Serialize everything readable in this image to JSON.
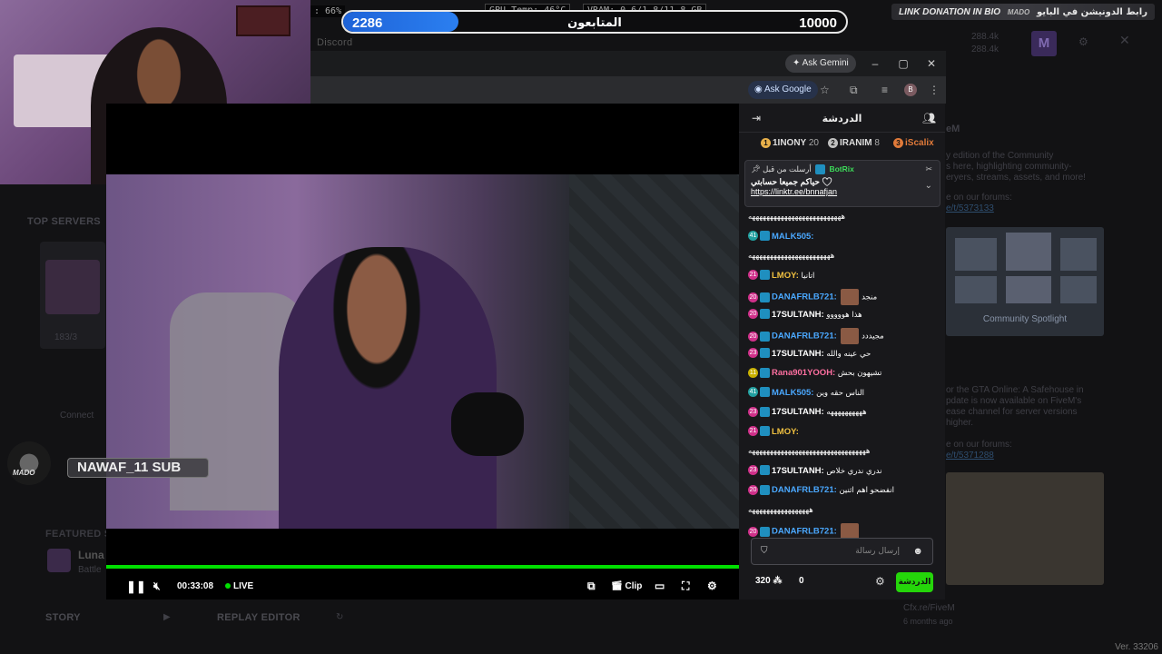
{
  "hud": {
    "fps_partial": ": 66%",
    "gpu_temp": "GPU Temp: 46°C",
    "vram": "VRAM: 0.6/1.8/11.8 GB",
    "goal_current": "2286",
    "goal_target": "10000",
    "goal_fraction": 0.2286,
    "goal_label": "المتابعون"
  },
  "banner": {
    "left_text": "LINK DONATION IN BIO",
    "right_text": "رابط الدونيشن في البايو",
    "logo_text": "MADO"
  },
  "background": {
    "discord_link": "Discord",
    "top_servers": "TOP SERVERS",
    "featured": "FEATURED SE",
    "server_name": "Luna",
    "server_sub": "Battle",
    "players_count": "183/3",
    "connect": "Connect",
    "story": "STORY",
    "replay_editor": "REPLAY EDITOR",
    "stat1": "288.4k",
    "stat2": "288.4k",
    "m_avatar": "M",
    "news_title": "eM",
    "news_text1": "y edition of the Community",
    "news_text2": "s here, highlighting community-",
    "news_text3": "eryers, streams, assets, and more!",
    "news_forum1": "e on our forums:",
    "news_link1": "e/t/5373133",
    "news_text4": "or the GTA Online: A Safehouse in",
    "news_text5": "pdate is now available on FiveM's",
    "news_text6": "ease channel for server versions",
    "news_text7": "higher.",
    "news_forum2": "e on our forums:",
    "news_link2": "e/t/5371288",
    "cfx": "Cfx.re/FiveM",
    "ago": "6 months ago",
    "version": "Ver. 33206",
    "spotlight": "Community Spotlight"
  },
  "browser": {
    "ask_gemini": "Ask Gemini",
    "ask_google": "Ask Google",
    "avatar_letter": "B"
  },
  "player": {
    "time": "00:33:08",
    "live": "LIVE",
    "clip": "Clip",
    "progress": 1.0
  },
  "sub": {
    "name": "NAWAF_11 SUB",
    "logo": "MADO"
  },
  "chat": {
    "title": "الدردشة",
    "leaderboard": [
      {
        "rank": "1",
        "name": "1INONY",
        "count": "20",
        "color": "#e8b04a"
      },
      {
        "rank": "2",
        "name": "IRANIM",
        "count": "8",
        "color": "#c0c0c0"
      },
      {
        "rank": "3",
        "name": "iScalix",
        "count": "",
        "color": "#e07a3a"
      }
    ],
    "pinned": {
      "sent_by": "أرسلت من قبل",
      "bot": "BotRix",
      "text": "حياكم جميعا حسابتي",
      "link": "https://linktr.ee/bnnafjan"
    },
    "messages": [
      {
        "badge": "",
        "badge_color": "",
        "user": "",
        "user_color": "#fff",
        "text": "ههههههههههههههههههههههههههه",
        "emote": false
      },
      {
        "badge": "41",
        "badge_color": "#22a0a0",
        "user": "MALK505:",
        "user_color": "#4aa8ff",
        "text": "",
        "emote": false
      },
      {
        "badge": "",
        "badge_color": "",
        "user": "",
        "user_color": "#fff",
        "text": "هههههههههههههههههههههههه",
        "emote": false
      },
      {
        "badge": "21",
        "badge_color": "#d0308a",
        "user": "LMOY:",
        "user_color": "#f0c040",
        "text": "اتانيا",
        "emote": false
      },
      {
        "badge": "20",
        "badge_color": "#d0308a",
        "user": "DANAFRLB721:",
        "user_color": "#4aa8ff",
        "text": "منجد",
        "emote": true
      },
      {
        "badge": "20",
        "badge_color": "#d0308a",
        "user": "17SULTANH:",
        "user_color": "#ffffff",
        "text": "هذا هووووو",
        "emote": false
      },
      {
        "badge": "20",
        "badge_color": "#d0308a",
        "user": "DANAFRLB721:",
        "user_color": "#4aa8ff",
        "text": "مجيددد",
        "emote": true
      },
      {
        "badge": "23",
        "badge_color": "#d0308a",
        "user": "17SULTANH:",
        "user_color": "#ffffff",
        "text": "حي عينه والله",
        "emote": false
      },
      {
        "badge": "11",
        "badge_color": "#c8b000",
        "user": "Rana901YOOH:",
        "user_color": "#ff6fa0",
        "text": "تشيهون بحش",
        "emote": false
      },
      {
        "badge": "41",
        "badge_color": "#22a0a0",
        "user": "MALK505:",
        "user_color": "#4aa8ff",
        "text": "الناس حقه وين",
        "emote": false
      },
      {
        "badge": "23",
        "badge_color": "#d0308a",
        "user": "17SULTANH:",
        "user_color": "#ffffff",
        "text": "ههههههههههه",
        "emote": false
      },
      {
        "badge": "21",
        "badge_color": "#d0308a",
        "user": "LMOY:",
        "user_color": "#f0c040",
        "text": "",
        "emote": false
      },
      {
        "badge": "",
        "badge_color": "",
        "user": "",
        "user_color": "#fff",
        "text": "هههههههههههههههههههههههههههههههههه",
        "emote": false
      },
      {
        "badge": "23",
        "badge_color": "#d0308a",
        "user": "17SULTANH:",
        "user_color": "#ffffff",
        "text": "ندري ندري خلاص",
        "emote": false
      },
      {
        "badge": "20",
        "badge_color": "#d0308a",
        "user": "DANAFRLB721:",
        "user_color": "#4aa8ff",
        "text": "انفضحو اهم اثنين",
        "emote": false
      },
      {
        "badge": "",
        "badge_color": "",
        "user": "",
        "user_color": "#fff",
        "text": "هههههههههههههههههه",
        "emote": false
      },
      {
        "badge": "20",
        "badge_color": "#d0308a",
        "user": "DANAFRLB721:",
        "user_color": "#4aa8ff",
        "text": "",
        "emote": true
      }
    ],
    "input_placeholder": "إرسال رسالة",
    "points": "320",
    "viewers": "0",
    "send": "الدردشة"
  }
}
